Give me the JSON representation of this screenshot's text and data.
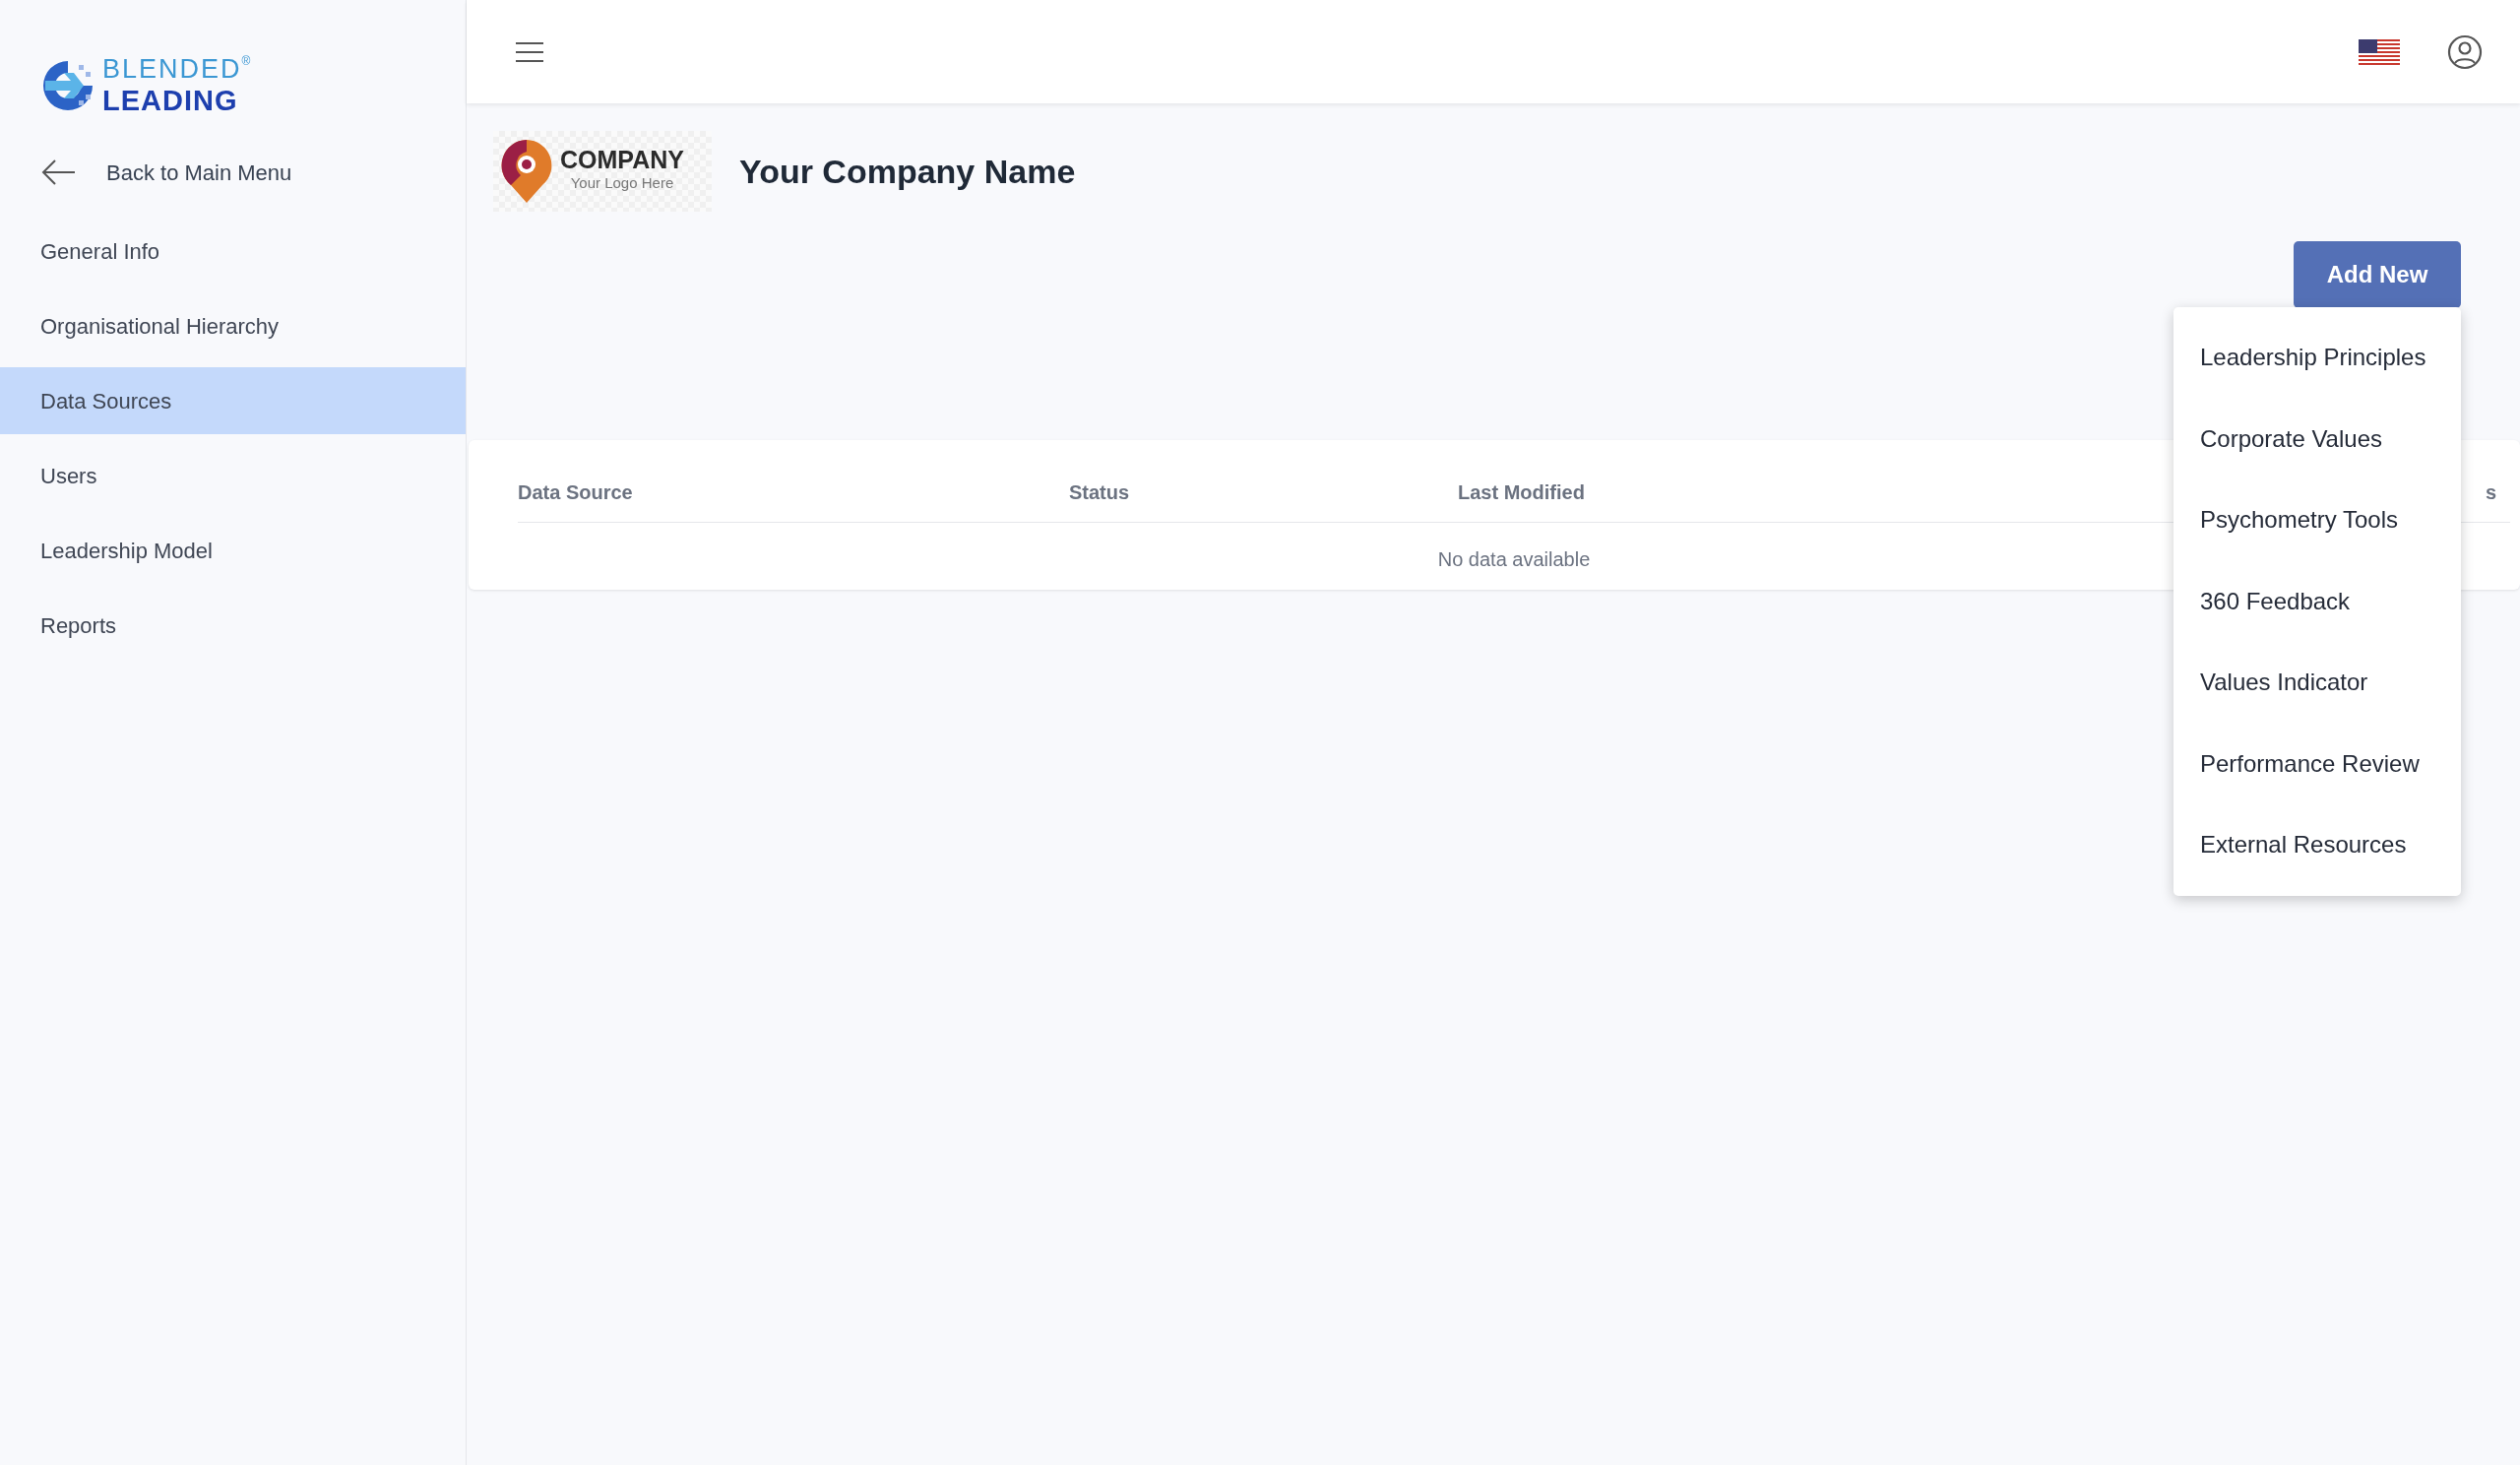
{
  "brand": {
    "line_1": "BLENDED",
    "line_2": "LEADING",
    "mark": "®"
  },
  "sidebar": {
    "back_link": "Back to Main Menu",
    "items": [
      {
        "label": "General Info",
        "selected": false
      },
      {
        "label": "Organisational Hierarchy",
        "selected": false
      },
      {
        "label": "Data Sources",
        "selected": true
      },
      {
        "label": "Users",
        "selected": false
      },
      {
        "label": "Leadership Model",
        "selected": false
      },
      {
        "label": "Reports",
        "selected": false
      }
    ]
  },
  "company": {
    "logo_title": "COMPANY",
    "logo_subtitle": "Your Logo Here",
    "name": "Your Company Name"
  },
  "add_button": {
    "label": "Add New"
  },
  "add_menu": [
    "Leadership Principles",
    "Corporate Values",
    "Psychometry Tools",
    "360 Feedback",
    "Values Indicator",
    "Performance Review",
    "External Resources"
  ],
  "table": {
    "columns": [
      "Data Source",
      "Status",
      "Last Modified",
      "s"
    ],
    "empty_text": "No data available"
  }
}
